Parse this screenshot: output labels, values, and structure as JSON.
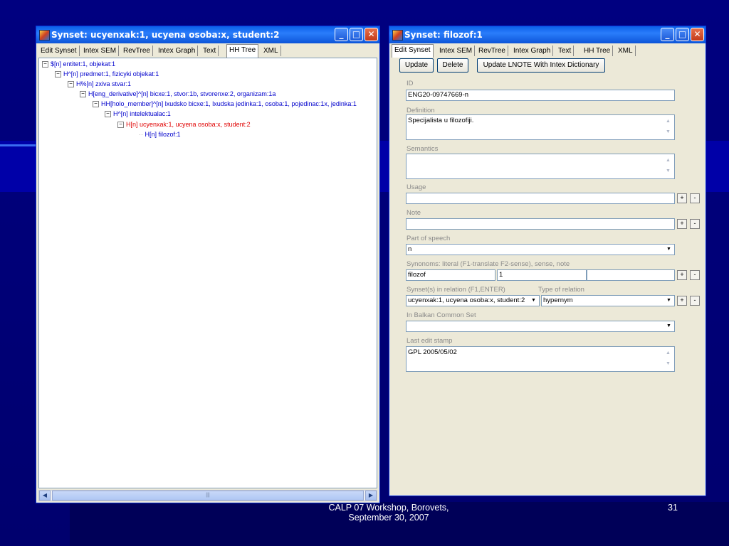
{
  "left_window": {
    "title": "Synset: ucyenxak:1, ucyena osoba:x, student:2",
    "tabs": [
      "Edit Synset",
      "Intex SEM",
      "RevTree",
      "Intex Graph",
      "Text",
      "HH Tree",
      "XML"
    ],
    "active_tab": "HH Tree",
    "tree": [
      {
        "text": "$[n] entitet:1, objekat:1",
        "depth": 0,
        "expander": "⊟"
      },
      {
        "text": "H^[n] predmet:1, fizicyki objekat:1",
        "depth": 1,
        "expander": "⊟"
      },
      {
        "text": "H%[n] zxiva stvar:1",
        "depth": 2,
        "expander": "⊟"
      },
      {
        "text": "H[eng_derivative]^[n] bicxe:1, stvor:1b, stvorenxe:2, organizam:1a",
        "depth": 3,
        "expander": "⊟"
      },
      {
        "text": "HH[holo_member]^[n] lxudsko bicxe:1, lxudska jedinka:1, osoba:1, pojedinac:1x, jedinka:1",
        "depth": 4,
        "expander": "⊟"
      },
      {
        "text": "H^[n] intelektualac:1",
        "depth": 5,
        "expander": "⊟"
      },
      {
        "text": "H[n] ucyenxak:1, ucyena osoba:x, student:2",
        "depth": 6,
        "expander": "⊟"
      },
      {
        "text": "H[n] filozof:1",
        "depth": 7,
        "expander": ""
      }
    ],
    "scroll_thumb_glyph": "|||"
  },
  "right_window": {
    "title": "Synset: filozof:1",
    "tabs": [
      "Edit Synset",
      "Intex SEM",
      "RevTree",
      "Intex Graph",
      "Text",
      "HH Tree",
      "XML"
    ],
    "active_tab": "Edit Synset",
    "buttons": {
      "update": "Update",
      "delete": "Delete",
      "update_lnote": "Update LNOTE With Intex Dictionary"
    },
    "fields": {
      "id_label": "ID",
      "id_value": "ENG20-09747669-n",
      "definition_label": "Definition",
      "definition_value": "Specijalista u filozofiji.",
      "semantics_label": "Semantics",
      "semantics_value": "",
      "usage_label": "Usage",
      "usage_value": "",
      "note_label": "Note",
      "note_value": "",
      "pos_label": "Part of speech",
      "pos_value": "n",
      "synonyms_label": "Synonoms: literal (F1-translate F2-sense), sense, note",
      "synonym_literal": "filozof",
      "synonym_sense": "1",
      "synonym_note": "",
      "relation_label": "Synset(s) in relation (F1,ENTER)",
      "relation_type_label": "Type of relation",
      "relation_synset": "ucyenxak:1, ucyena osoba:x, student:2",
      "relation_type": "hypernym",
      "balkan_label": "In Balkan Common Set",
      "balkan_value": "",
      "stamp_label": "Last edit stamp",
      "stamp_value": "GPL 2005/05/02"
    },
    "plus": "+",
    "minus": "-"
  },
  "window_controls": {
    "minimize": "_",
    "maximize": "□",
    "close": "✕"
  },
  "icons": {
    "expander": "minus-box-icon",
    "dropdown": "▼",
    "scroll_left": "◀",
    "scroll_right": "▶",
    "scroll_up": "▲",
    "scroll_down": "▼"
  },
  "footer": {
    "line1": "CALP 07 Workshop, Borovets,",
    "line2": "September 30, 2007",
    "page": "31"
  },
  "colors": {
    "titlebar": "#0a5fe8",
    "tree_link": "#0000cc",
    "tree_current": "#e00000",
    "selection": "#316ac5",
    "slide_bg": "#000080"
  }
}
